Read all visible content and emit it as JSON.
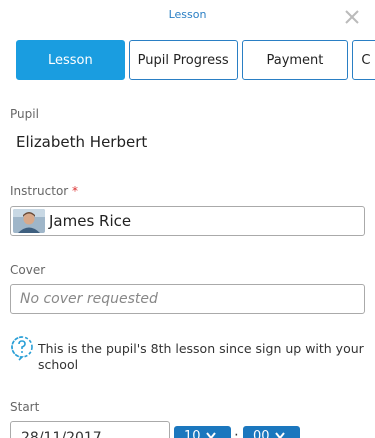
{
  "window": {
    "title": "Lesson"
  },
  "tabs": [
    {
      "label": "Lesson",
      "active": true
    },
    {
      "label": "Pupil Progress",
      "active": false
    },
    {
      "label": "Payment",
      "active": false
    },
    {
      "label": "C",
      "active": false
    }
  ],
  "pupil": {
    "label": "Pupil",
    "value": "Elizabeth Herbert"
  },
  "instructor": {
    "label": "Instructor",
    "required_marker": "*",
    "value": "James Rice"
  },
  "cover": {
    "label": "Cover",
    "placeholder": "No cover requested"
  },
  "info": {
    "icon": "question-icon",
    "text": "This is the pupil's 8th lesson since sign up with your school"
  },
  "start": {
    "label": "Start",
    "date": "28/11/2017",
    "hour": "10",
    "separator": ":",
    "minute": "00"
  },
  "colors": {
    "accent": "#1a9de0",
    "border_blue": "#2a7fc4",
    "select_blue": "#1b77be"
  }
}
